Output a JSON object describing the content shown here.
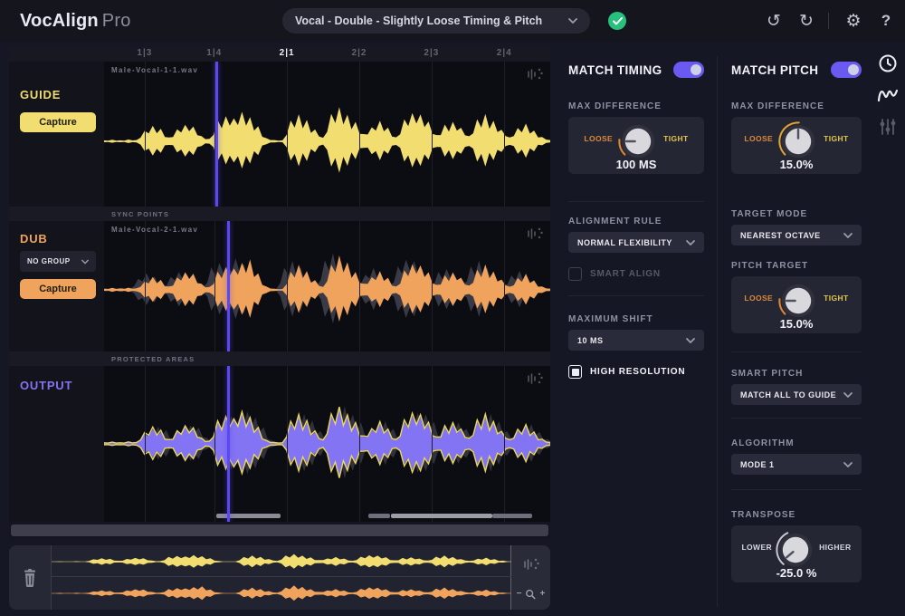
{
  "app": {
    "brand": "VocAlign",
    "brand_suffix": "Pro"
  },
  "topbar": {
    "preset_value": "Vocal - Double - Slightly Loose Timing & Pitch",
    "undo": "↺",
    "redo": "↻",
    "settings": "⚙",
    "help": "?",
    "status": "preset-applied"
  },
  "ruler": {
    "ticks": [
      {
        "label": "1|3",
        "pos": 9.1,
        "active": false
      },
      {
        "label": "1|4",
        "pos": 24.7,
        "active": false
      },
      {
        "label": "2|1",
        "pos": 41.0,
        "active": true
      },
      {
        "label": "2|2",
        "pos": 57.2,
        "active": false
      },
      {
        "label": "2|3",
        "pos": 73.4,
        "active": false
      },
      {
        "label": "2|4",
        "pos": 89.7,
        "active": false
      }
    ]
  },
  "tracks": {
    "guide": {
      "name": "GUIDE",
      "button": "Capture",
      "file": "Male-Vocal-1-1.wav",
      "color": "#f1dd70",
      "playhead": 24.9
    },
    "dub": {
      "name": "DUB",
      "group": "NO GROUP",
      "button": "Capture",
      "file": "Male-Vocal-2-1.wav",
      "color": "#efa35c",
      "playhead": 27.6
    },
    "output": {
      "name": "OUTPUT",
      "color": "#8374f4",
      "outline": "#e9d75e",
      "playhead": 27.6
    },
    "sync_bar": "SYNC POINTS",
    "protected_bar": "PROTECTED AREAS",
    "processed_segments": [
      {
        "left": 25.2,
        "width": 14.4,
        "color": "#8b8c96"
      },
      {
        "left": 59.2,
        "width": 5.0,
        "color": "#6e6f7c"
      },
      {
        "left": 64.2,
        "width": 22.8,
        "color": "#9c9da6"
      },
      {
        "left": 87.0,
        "width": 9.0,
        "color": "#6e6f7c"
      }
    ]
  },
  "timing": {
    "title": "MATCH TIMING",
    "enabled": true,
    "max_difference": {
      "label": "MAX DIFFERENCE",
      "left": "LOOSE",
      "right": "TIGHT",
      "value": "100 MS",
      "pointer": -90,
      "arc_start": -135,
      "arc_end": -85,
      "arc_color": "#e2862f"
    },
    "alignment_rule": {
      "label": "ALIGNMENT RULE",
      "value": "NORMAL FLEXIBILITY"
    },
    "smart_align": {
      "label": "SMART ALIGN",
      "checked": false
    },
    "maximum_shift": {
      "label": "MAXIMUM SHIFT",
      "value": "10 MS"
    },
    "high_resolution": {
      "label": "HIGH RESOLUTION",
      "checked": true
    }
  },
  "pitch": {
    "title": "MATCH PITCH",
    "enabled": true,
    "max_difference": {
      "label": "MAX DIFFERENCE",
      "left": "LOOSE",
      "right": "TIGHT",
      "value": "15.0%",
      "pointer": 0,
      "arc_start": -135,
      "arc_end": 2,
      "arc_color": "#e2a52f"
    },
    "target_mode": {
      "label": "TARGET MODE",
      "value": "NEAREST OCTAVE"
    },
    "pitch_target": {
      "label": "PITCH TARGET",
      "left": "LOOSE",
      "right": "TIGHT",
      "value": "15.0%",
      "pointer": -90,
      "arc_start": -135,
      "arc_end": -85,
      "arc_color": "#e2862f"
    },
    "smart_pitch": {
      "label": "SMART PITCH",
      "value": "MATCH ALL TO GUIDE"
    },
    "algorithm": {
      "label": "ALGORITHM",
      "value": "MODE 1"
    },
    "transpose": {
      "label": "TRANSPOSE",
      "left": "LOWER",
      "right": "HIGHER",
      "value": "-25.0 %",
      "pointer": -130,
      "arc_start": -140,
      "arc_end": -25,
      "arc_color": "#c6c7d2"
    }
  },
  "side_tabs": [
    {
      "name": "timing-clock",
      "active": true
    },
    {
      "name": "pitch-wave",
      "active": true
    },
    {
      "name": "settings-sliders",
      "active": false
    }
  ],
  "overview": {
    "zoom_out": "−",
    "zoom_in": "+"
  },
  "colors": {
    "accent_purple": "#6a5af2",
    "playhead": "#5b48f0",
    "guide_yellow": "#f1dd70",
    "dub_orange": "#efa35c",
    "output_purple": "#8374f4",
    "check_green": "#27c07d",
    "ghost_gray": "#42434f"
  },
  "waveforms": {
    "guide": [
      0.02,
      0.03,
      0.02,
      0.04,
      0.03,
      0.22,
      0.3,
      0.24,
      0.08,
      0.28,
      0.38,
      0.3,
      0.1,
      0.05,
      0.45,
      0.62,
      0.5,
      0.58,
      0.46,
      0.3,
      0.07,
      0.03,
      0.02,
      0.4,
      0.52,
      0.44,
      0.28,
      0.08,
      0.55,
      0.65,
      0.52,
      0.42,
      0.18,
      0.3,
      0.4,
      0.26,
      0.08,
      0.5,
      0.66,
      0.55,
      0.38,
      0.12,
      0.35,
      0.47,
      0.3,
      0.1,
      0.42,
      0.54,
      0.45,
      0.28,
      0.08,
      0.26,
      0.34,
      0.22,
      0.1,
      0.03
    ],
    "dub": [
      0.02,
      0.04,
      0.03,
      0.05,
      0.04,
      0.18,
      0.26,
      0.2,
      0.07,
      0.3,
      0.42,
      0.34,
      0.12,
      0.06,
      0.4,
      0.58,
      0.48,
      0.55,
      0.6,
      0.34,
      0.08,
      0.03,
      0.02,
      0.36,
      0.5,
      0.4,
      0.24,
      0.07,
      0.52,
      0.68,
      0.56,
      0.4,
      0.16,
      0.28,
      0.38,
      0.24,
      0.07,
      0.46,
      0.62,
      0.52,
      0.35,
      0.1,
      0.32,
      0.44,
      0.28,
      0.09,
      0.4,
      0.52,
      0.42,
      0.26,
      0.07,
      0.24,
      0.32,
      0.2,
      0.08,
      0.03
    ],
    "output": [
      0.02,
      0.03,
      0.02,
      0.04,
      0.03,
      0.2,
      0.28,
      0.22,
      0.08,
      0.3,
      0.4,
      0.32,
      0.11,
      0.05,
      0.44,
      0.62,
      0.52,
      0.58,
      0.52,
      0.32,
      0.07,
      0.03,
      0.02,
      0.38,
      0.52,
      0.42,
      0.26,
      0.08,
      0.54,
      0.66,
      0.54,
      0.41,
      0.17,
      0.29,
      0.39,
      0.25,
      0.08,
      0.48,
      0.64,
      0.54,
      0.37,
      0.11,
      0.34,
      0.46,
      0.29,
      0.09,
      0.41,
      0.53,
      0.44,
      0.27,
      0.08,
      0.25,
      0.33,
      0.21,
      0.09,
      0.03
    ]
  }
}
